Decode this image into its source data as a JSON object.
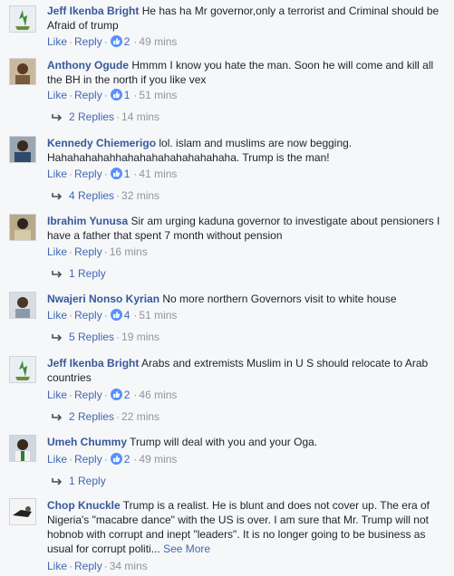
{
  "actions": {
    "like": "Like",
    "reply": "Reply",
    "sep": "·"
  },
  "comments": [
    {
      "author": "Jeff Ikenba Bright",
      "text": "He has ha Mr governor,only a terrorist and Criminal should be Afraid of trump",
      "likes": "2",
      "time": "49 mins"
    },
    {
      "author": "Anthony Ogude",
      "text": "Hmmm I know you hate the man. Soon he will come and kill all the BH in the north if you like vex",
      "likes": "1",
      "time": "51 mins",
      "replies": "2 Replies",
      "replies_time": "14 mins"
    },
    {
      "author": "Kennedy Chiemerigo",
      "text": "lol. islam and muslims are now begging. Hahahahahahhahahahahahahahahaha. Trump is the man!",
      "likes": "1",
      "time": "41 mins",
      "replies": "4 Replies",
      "replies_time": "32 mins"
    },
    {
      "author": "Ibrahim Yunusa",
      "text": "Sir am urging kaduna governor to investigate about pensioners I have a father that spent 7 month without pension",
      "time": "16 mins",
      "replies": "1 Reply"
    },
    {
      "author": "Nwajeri Nonso Kyrian",
      "text": "No more northern Governors visit to white house",
      "likes": "4",
      "time": "51 mins",
      "replies": "5 Replies",
      "replies_time": "19 mins"
    },
    {
      "author": "Jeff Ikenba Bright",
      "text": "Arabs and extremists Muslim in U S should relocate to Arab countries",
      "likes": "2",
      "time": "46 mins",
      "replies": "2 Replies",
      "replies_time": "22 mins"
    },
    {
      "author": "Umeh Chummy",
      "text": "Trump will deal with you and your Oga.",
      "likes": "2",
      "time": "49 mins",
      "replies": "1 Reply"
    },
    {
      "author": "Chop Knuckle",
      "text": "Trump is a realist. He is blunt and does not cover up. The era of Nigeria's \"macabre dance\" with the US is over. I am sure that Mr. Trump will not hobnob with corrupt and inept \"leaders\". It is no longer going to be business as usual for corrupt politi...",
      "see_more": "See More",
      "time": "34 mins"
    }
  ]
}
